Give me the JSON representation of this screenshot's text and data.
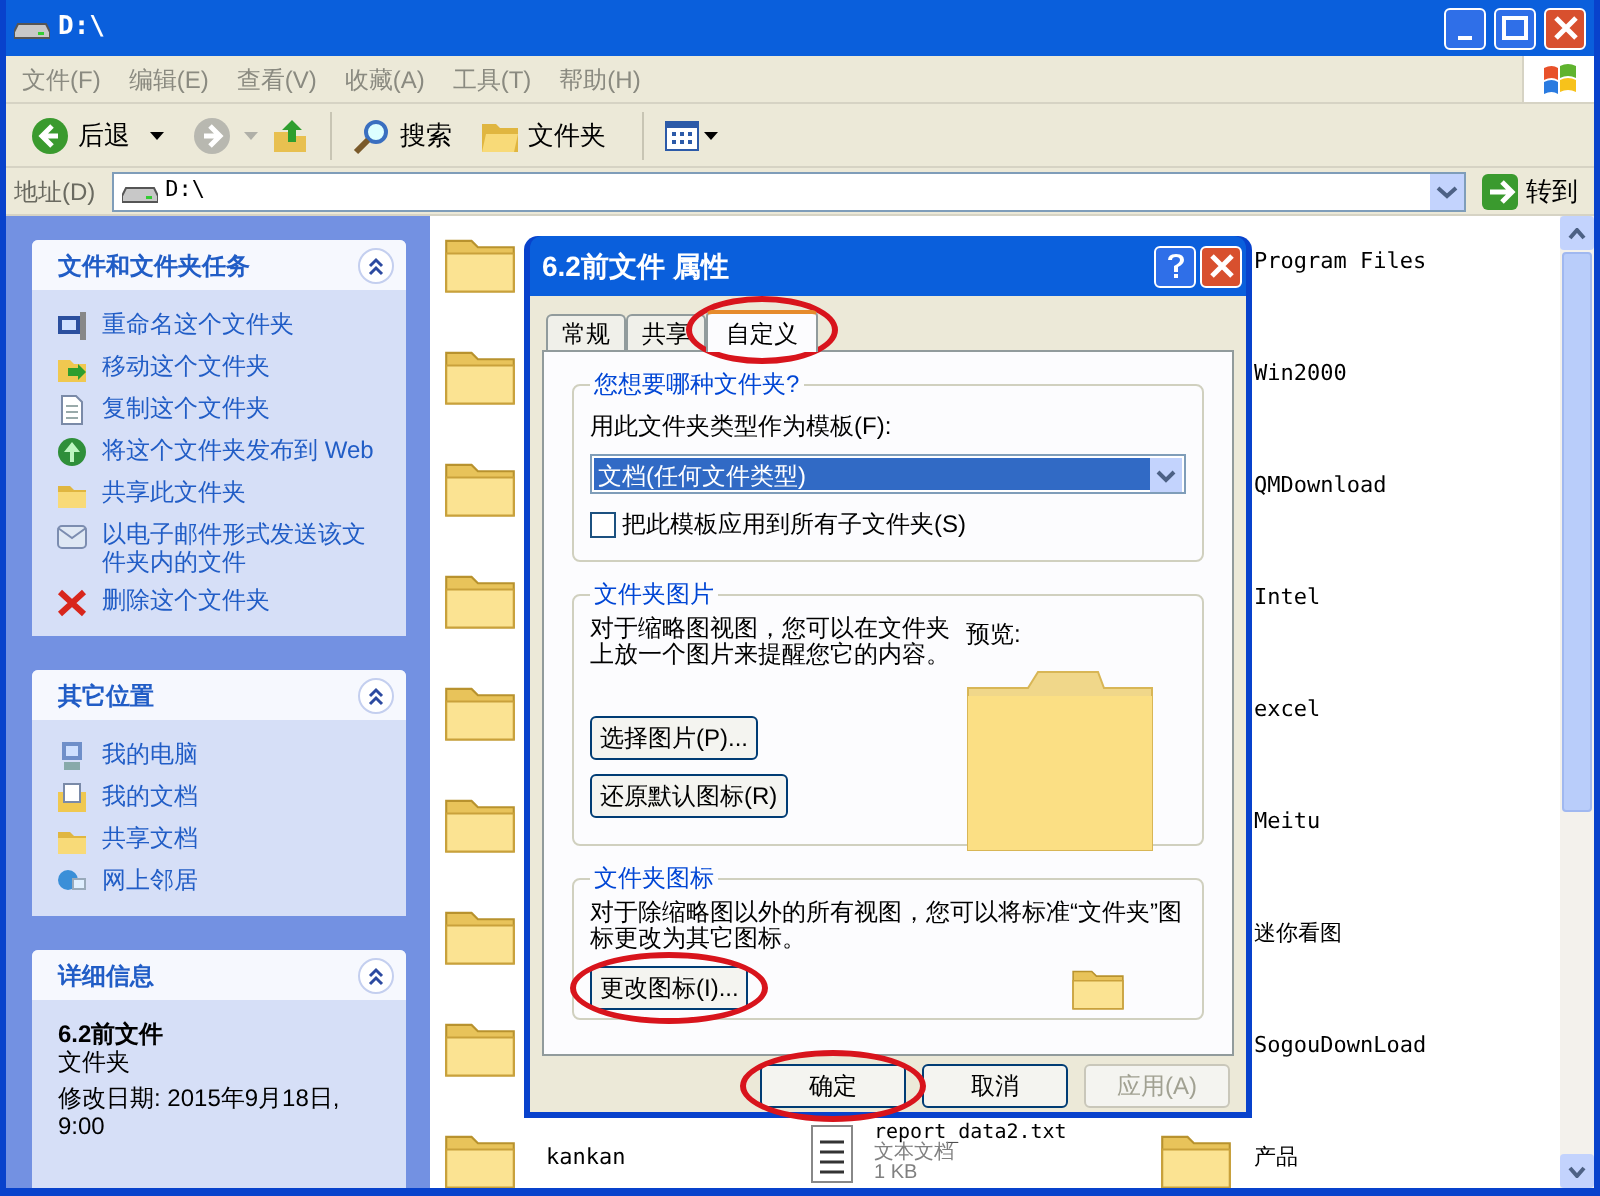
{
  "window": {
    "title": "D:\\"
  },
  "menu": [
    "文件(F)",
    "编辑(E)",
    "查看(V)",
    "收藏(A)",
    "工具(T)",
    "帮助(H)"
  ],
  "toolbar": {
    "back": "后退",
    "search": "搜索",
    "folders": "文件夹"
  },
  "address": {
    "label": "地址(D)",
    "value": "D:\\",
    "go": "转到"
  },
  "task_panels": [
    {
      "title": "文件和文件夹任务",
      "expanded": true,
      "items": [
        {
          "label": "重命名这个文件夹",
          "kind": "rename"
        },
        {
          "label": "移动这个文件夹",
          "kind": "move"
        },
        {
          "label": "复制这个文件夹",
          "kind": "copy"
        },
        {
          "label": "将这个文件夹发布到 Web",
          "kind": "publish"
        },
        {
          "label": "共享此文件夹",
          "kind": "share"
        },
        {
          "label": "以电子邮件形式发送该文件夹内的文件",
          "kind": "email"
        },
        {
          "label": "删除这个文件夹",
          "kind": "delete"
        }
      ]
    },
    {
      "title": "其它位置",
      "expanded": true,
      "items": [
        {
          "label": "我的电脑",
          "kind": "computer"
        },
        {
          "label": "我的文档",
          "kind": "documents"
        },
        {
          "label": "共享文档",
          "kind": "share"
        },
        {
          "label": "网上邻居",
          "kind": "network"
        }
      ]
    }
  ],
  "details": {
    "title": "详细信息",
    "expanded": true,
    "name": "6.2前文件",
    "type": "文件夹",
    "modified": "修改日期: 2015年9月18日, 9:00"
  },
  "files": [
    {
      "kind": "folder"
    },
    {
      "kind": "folder"
    },
    {
      "kind": "folder"
    },
    {
      "kind": "folder"
    },
    {
      "kind": "folder"
    },
    {
      "kind": "folder"
    },
    {
      "kind": "folder"
    },
    {
      "kind": "folder"
    },
    {
      "kind": "folder",
      "name": "kankan"
    },
    {
      "kind": "text",
      "name": "report_data2.txt",
      "type": "文本文档",
      "size": "1 KB"
    }
  ],
  "files_right": [
    {
      "name": "Program Files",
      "kind": "name_only"
    },
    {
      "name": "Win2000",
      "kind": "name_only"
    },
    {
      "name": "QMDownload",
      "kind": "name_only"
    },
    {
      "name": "Intel",
      "kind": "name_only"
    },
    {
      "name": "excel",
      "kind": "name_only"
    },
    {
      "name": "Meitu",
      "kind": "name_only"
    },
    {
      "name": "迷你看图",
      "kind": "name_only"
    },
    {
      "name": "SogouDownLoad",
      "kind": "name_only"
    },
    {
      "name": "产品",
      "kind": "folder"
    }
  ],
  "dialog": {
    "title": "6.2前文件 属性",
    "tabs": [
      {
        "label": "常规",
        "selected": false,
        "highlighted": false
      },
      {
        "label": "共享",
        "selected": false,
        "highlighted": false
      },
      {
        "label": "自定义",
        "selected": true,
        "highlighted": true
      }
    ],
    "type_group": {
      "title": "您想要哪种文件夹?",
      "template_label": "用此文件夹类型作为模板(F):",
      "template_value": "文档(任何文件类型)",
      "apply_label": "把此模板应用到所有子文件夹(S)",
      "checked": false
    },
    "picture_group": {
      "title": "文件夹图片",
      "description": "对于缩略图视图，您可以在文件夹上放一个图片来提醒您它的内容。",
      "preview_label": "预览:",
      "buttons": [
        {
          "label": "选择图片(P)..."
        },
        {
          "label": "还原默认图标(R)"
        }
      ]
    },
    "icon_group": {
      "title": "文件夹图标",
      "description": "对于除缩略图以外的所有视图，您可以将标准“文件夹”图标更改为其它图标。",
      "button": {
        "label": "更改图标(I)...",
        "highlighted": true
      }
    },
    "buttons": [
      {
        "label": "确定",
        "disabled": false,
        "highlighted": true
      },
      {
        "label": "取消",
        "disabled": false,
        "highlighted": false
      },
      {
        "label": "应用(A)",
        "disabled": true,
        "highlighted": false
      }
    ]
  }
}
